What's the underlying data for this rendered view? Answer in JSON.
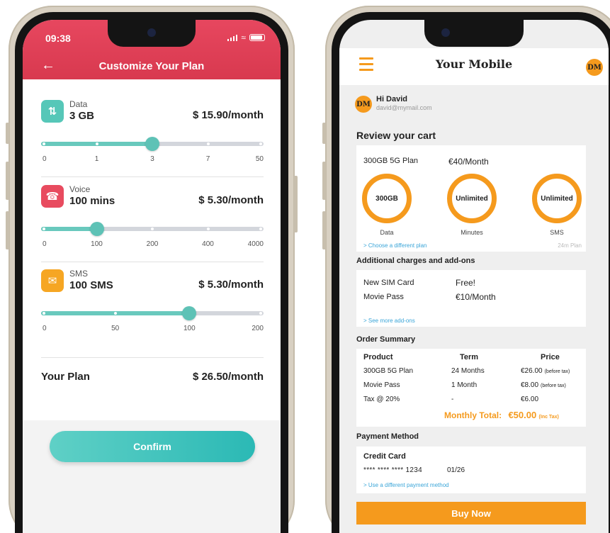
{
  "left_phone": {
    "status": {
      "time": "09:38"
    },
    "header": {
      "back_icon": "arrow-left-icon",
      "title": "Customize Your Plan"
    },
    "cards": [
      {
        "label": "Data",
        "value": "3 GB",
        "price": "$ 15.90/month",
        "icon": "arrows-up-down-icon",
        "icon_color": "#56c7b8",
        "ticks": [
          "0",
          "1",
          "3",
          "7",
          "50"
        ],
        "selected_index": 2
      },
      {
        "label": "Voice",
        "value": "100 mins",
        "price": "$ 5.30/month",
        "icon": "phone-icon",
        "icon_color": "#e84b5f",
        "ticks": [
          "0",
          "100",
          "200",
          "400",
          "4000"
        ],
        "selected_index": 1
      },
      {
        "label": "SMS",
        "value": "100 SMS",
        "price": "$ 5.30/month",
        "icon": "envelope-icon",
        "icon_color": "#f6a623",
        "ticks": [
          "0",
          "50",
          "100",
          "200"
        ],
        "selected_index": 2
      }
    ],
    "plan": {
      "label": "Your Plan",
      "price": "$ 26.50/month"
    },
    "confirm_label": "Confirm",
    "colors": {
      "header": "#e2445a",
      "accent": "#5ec2b6"
    }
  },
  "right_phone": {
    "topbar": {
      "menu_icon": "hamburger-menu-icon",
      "brand": "Your Mobile",
      "avatar": "DM"
    },
    "user": {
      "avatar": "DM",
      "greeting": "Hi David",
      "email": "david@mymail.com"
    },
    "cart_heading": "Review your cart",
    "plan": {
      "name": "300GB 5G Plan",
      "price": "€40/Month",
      "rings": [
        {
          "value": "300GB",
          "caption": "Data"
        },
        {
          "value": "Unlimited",
          "caption": "Minutes"
        },
        {
          "value": "Unlimited",
          "caption": "SMS"
        }
      ],
      "change_link": "> Choose a different plan",
      "term_note": "24m Plan"
    },
    "addons_heading": "Additional charges and add-ons",
    "addons": [
      {
        "name": "New SIM Card",
        "value": "Free!"
      },
      {
        "name": "Movie Pass",
        "value": "€10/Month"
      }
    ],
    "addons_link": "> See more add-ons",
    "order_heading": "Order Summary",
    "order": {
      "headers": [
        "Product",
        "Term",
        "Price"
      ],
      "rows": [
        {
          "product": "300GB 5G Plan",
          "term": "24 Months",
          "price": "€26.00",
          "note": "(before tax)"
        },
        {
          "product": "Movie Pass",
          "term": "1 Month",
          "price": "€8.00",
          "note": "(before tax)"
        },
        {
          "product": "Tax @ 20%",
          "term": "-",
          "price": "€6.00",
          "note": ""
        }
      ],
      "total_label": "Monthly Total:",
      "total_value": "€50.00",
      "total_note": "(Inc Tax)"
    },
    "payment_heading": "Payment Method",
    "payment": {
      "title": "Credit Card",
      "number": "**** **** **** 1234",
      "expiry": "01/26",
      "change_link": "> Use a different payment method"
    },
    "buy_label": "Buy Now",
    "colors": {
      "accent": "#f59a1d",
      "link": "#3aa5d8"
    }
  }
}
